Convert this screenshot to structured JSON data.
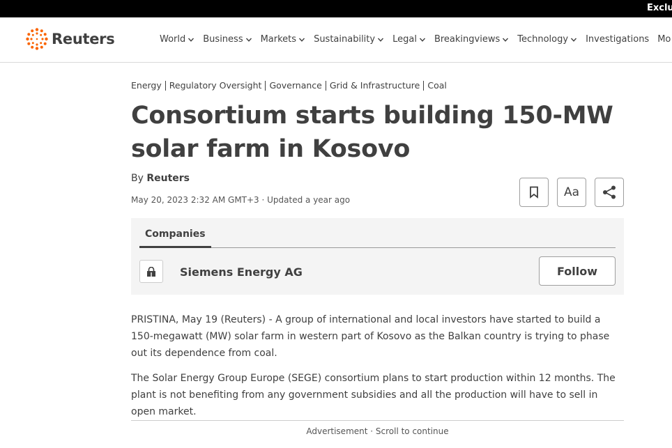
{
  "top_strip": {
    "text": "Exclus"
  },
  "header": {
    "logo_text": "Reuters",
    "nav": [
      {
        "label": "World",
        "has_chevron": true
      },
      {
        "label": "Business",
        "has_chevron": true
      },
      {
        "label": "Markets",
        "has_chevron": true
      },
      {
        "label": "Sustainability",
        "has_chevron": true
      },
      {
        "label": "Legal",
        "has_chevron": true
      },
      {
        "label": "Breakingviews",
        "has_chevron": true
      },
      {
        "label": "Technology",
        "has_chevron": true
      },
      {
        "label": "Investigations",
        "has_chevron": false
      },
      {
        "label": "Mo",
        "has_chevron": false
      }
    ]
  },
  "article": {
    "tags": [
      "Energy",
      "Regulatory Oversight",
      "Governance",
      "Grid & Infrastructure",
      "Coal"
    ],
    "headline": "Consortium starts building 150-MW solar farm in Kosovo",
    "byline_prefix": "By ",
    "byline_author": "Reuters",
    "dateline": "May 20, 2023 2:32 AM GMT+3 · Updated a year ago",
    "tools": {
      "bookmark_icon": "bookmark-icon",
      "text_size_label": "Aa",
      "share_icon": "share-icon"
    },
    "companies": {
      "tab_label": "Companies",
      "name": "Siemens Energy AG",
      "follow_label": "Follow",
      "lock_icon": "lock-icon"
    },
    "paragraphs": [
      "PRISTINA, May 19 (Reuters) - A group of international and local investors have started to build a 150-megawatt (MW) solar farm in western part of Kosovo as the Balkan country is trying to phase out its dependence from coal.",
      "The Solar Energy Group Europe (SEGE) consortium plans to start production within 12 months. The plant is not benefiting from any government subsidies and all the production will have to sell in open market."
    ],
    "ad_text": "Advertisement · Scroll to continue"
  },
  "colors": {
    "brand_orange": "#fa6400",
    "text": "#404040",
    "panel_bg": "#f4f4f4"
  }
}
